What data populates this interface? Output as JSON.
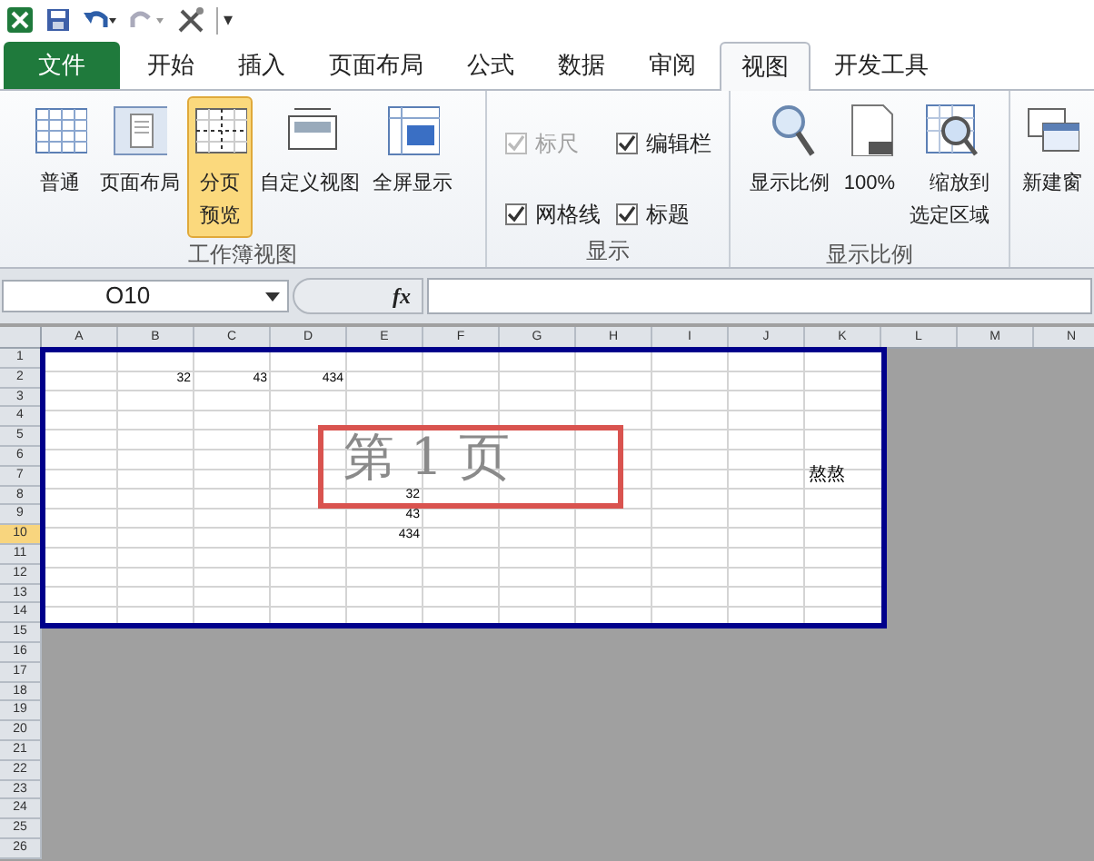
{
  "quick_access": {
    "menu_glyph": "▾"
  },
  "tabs": [
    {
      "label": "文件",
      "kind": "file",
      "selected": false
    },
    {
      "label": "开始",
      "kind": "tab",
      "selected": false
    },
    {
      "label": "插入",
      "kind": "tab",
      "selected": false
    },
    {
      "label": "页面布局",
      "kind": "tab",
      "selected": false
    },
    {
      "label": "公式",
      "kind": "tab",
      "selected": false
    },
    {
      "label": "数据",
      "kind": "tab",
      "selected": false
    },
    {
      "label": "审阅",
      "kind": "tab",
      "selected": false
    },
    {
      "label": "视图",
      "kind": "tab",
      "selected": true
    },
    {
      "label": "开发工具",
      "kind": "tab",
      "selected": false
    }
  ],
  "ribbon": {
    "groups": [
      {
        "label": "工作簿视图",
        "items": [
          {
            "kind": "normal",
            "label": "普通",
            "selected": false
          },
          {
            "kind": "page",
            "label": "页面布局",
            "selected": false
          },
          {
            "kind": "pagebreak",
            "label": "分页预览",
            "selected": true
          },
          {
            "kind": "custom",
            "label": "自定义视图",
            "selected": false
          },
          {
            "kind": "fullscreen",
            "label": "全屏显示",
            "selected": false
          }
        ]
      },
      {
        "label": "显示",
        "checkboxes": [
          {
            "label": "标尺",
            "checked": true,
            "disabled": true
          },
          {
            "label": "编辑栏",
            "checked": true,
            "disabled": false
          },
          {
            "label": "网格线",
            "checked": true,
            "disabled": false
          },
          {
            "label": "标题",
            "checked": true,
            "disabled": false
          }
        ]
      },
      {
        "label": "显示比例",
        "items": [
          {
            "kind": "zoom",
            "label": "显示比例",
            "selected": false
          },
          {
            "kind": "hundred",
            "label": "100%",
            "selected": false
          },
          {
            "kind": "zoomsel",
            "label": "缩放到选定区域",
            "selected": false
          }
        ]
      },
      {
        "items": [
          {
            "kind": "newwin",
            "label": "新建窗",
            "selected": false
          }
        ]
      }
    ]
  },
  "formula_bar": {
    "name_box": "O10",
    "fx": "fx"
  },
  "sheet": {
    "page_columns": [
      "A",
      "B",
      "C",
      "D",
      "E",
      "F",
      "G",
      "H",
      "I",
      "J",
      "K"
    ],
    "outside_columns": [
      "L",
      "M",
      "N"
    ],
    "page_rows": [
      {
        "label": "1",
        "selected": false
      },
      {
        "label": "2",
        "selected": false,
        "cells": [
          null,
          {
            "text": "32",
            "kind": "number"
          },
          {
            "text": "43",
            "kind": "number"
          },
          {
            "text": "434",
            "kind": "number"
          }
        ]
      },
      {
        "label": "3",
        "selected": false
      },
      {
        "label": "4",
        "selected": false
      },
      {
        "label": "5",
        "selected": false
      },
      {
        "label": "6",
        "selected": false
      },
      {
        "label": "7",
        "selected": false,
        "cells": [
          null,
          null,
          null,
          null,
          null,
          null,
          null,
          null,
          null,
          null,
          {
            "text": "熬熬",
            "kind": "text"
          }
        ]
      },
      {
        "label": "8",
        "selected": false,
        "cells": [
          null,
          null,
          null,
          null,
          {
            "text": "32",
            "kind": "number"
          }
        ]
      },
      {
        "label": "9",
        "selected": false,
        "cells": [
          null,
          null,
          null,
          null,
          {
            "text": "43",
            "kind": "number"
          }
        ]
      },
      {
        "label": "10",
        "selected": true,
        "cells": [
          null,
          null,
          null,
          null,
          {
            "text": "434",
            "kind": "number"
          }
        ]
      },
      {
        "label": "11",
        "selected": false
      },
      {
        "label": "12",
        "selected": false
      },
      {
        "label": "13",
        "selected": false
      },
      {
        "label": "14",
        "selected": false
      }
    ],
    "outside_rows": [
      {
        "label": "15",
        "selected": false
      },
      {
        "label": "16",
        "selected": false
      },
      {
        "label": "17",
        "selected": false
      },
      {
        "label": "18",
        "selected": false
      },
      {
        "label": "19",
        "selected": false
      },
      {
        "label": "20",
        "selected": false
      },
      {
        "label": "21",
        "selected": false
      },
      {
        "label": "22",
        "selected": false
      },
      {
        "label": "23",
        "selected": false
      },
      {
        "label": "24",
        "selected": false
      },
      {
        "label": "25",
        "selected": false
      },
      {
        "label": "26",
        "selected": false
      }
    ],
    "page_label": "第 1 页"
  }
}
